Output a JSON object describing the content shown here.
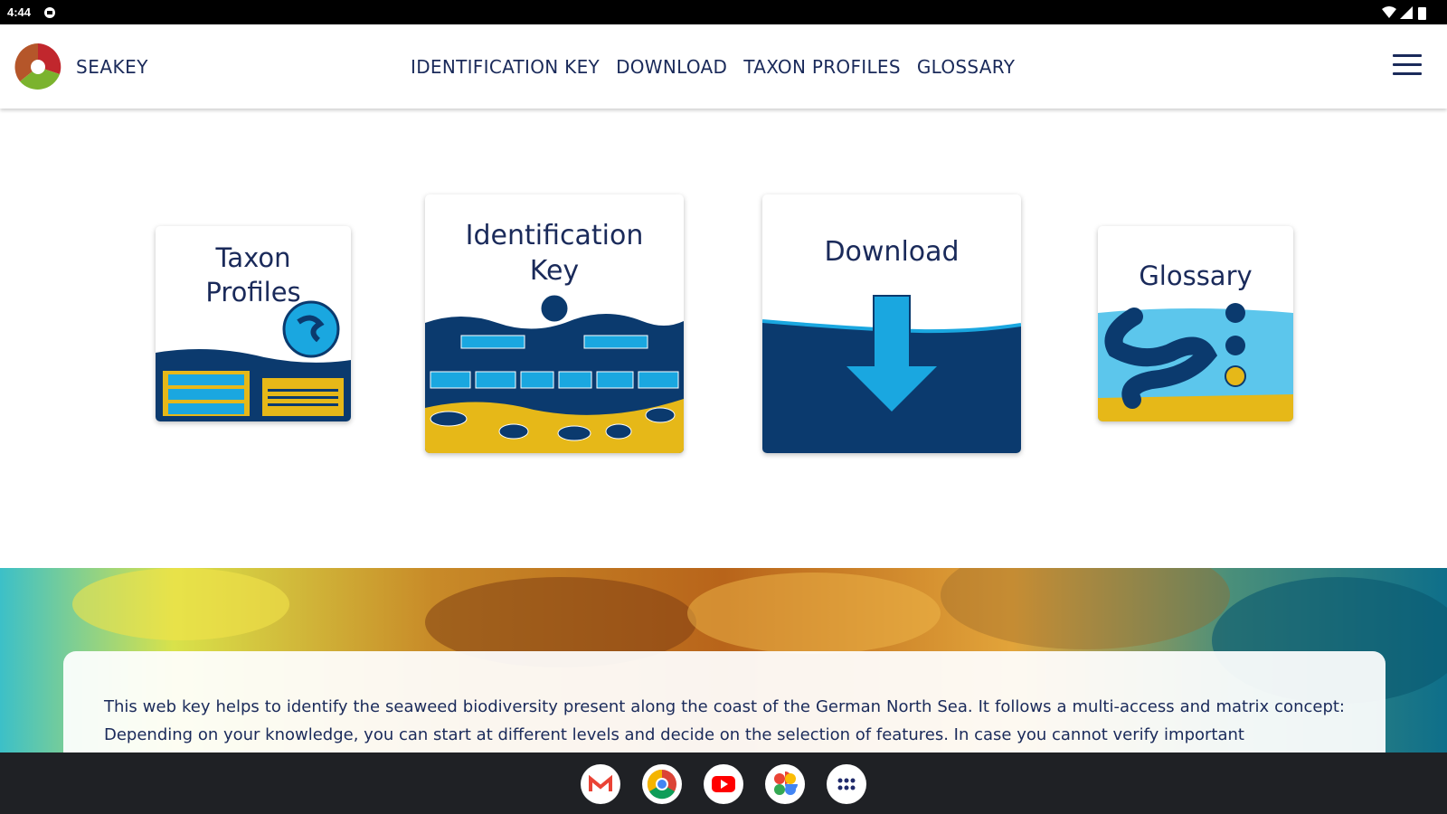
{
  "status_bar": {
    "time": "4:44"
  },
  "header": {
    "brand": "SEAKEY",
    "nav": [
      "IDENTIFICATION KEY",
      "DOWNLOAD",
      "TAXON PROFILES",
      "GLOSSARY"
    ]
  },
  "cards": {
    "taxon": {
      "line1": "Taxon",
      "line2": "Profiles"
    },
    "idkey": {
      "line1": "Identification",
      "line2": "Key"
    },
    "download": {
      "label": "Download"
    },
    "glossary": {
      "label": "Glossary"
    }
  },
  "intro": {
    "text": "This web key helps to identify the seaweed biodiversity present along the coast of the German North Sea. It follows a multi-access and matrix concept: Depending on your knowledge, you can start at different levels and decide on the selection of features. In case you cannot verify important"
  },
  "dock": {
    "apps": [
      "gmail-icon",
      "chrome-icon",
      "youtube-icon",
      "photos-icon",
      "apps-grid-icon"
    ]
  },
  "colors": {
    "navy": "#1a2a5a",
    "ocean": "#0b3a6e",
    "sky": "#1aa7e0",
    "sand": "#e6b818"
  }
}
